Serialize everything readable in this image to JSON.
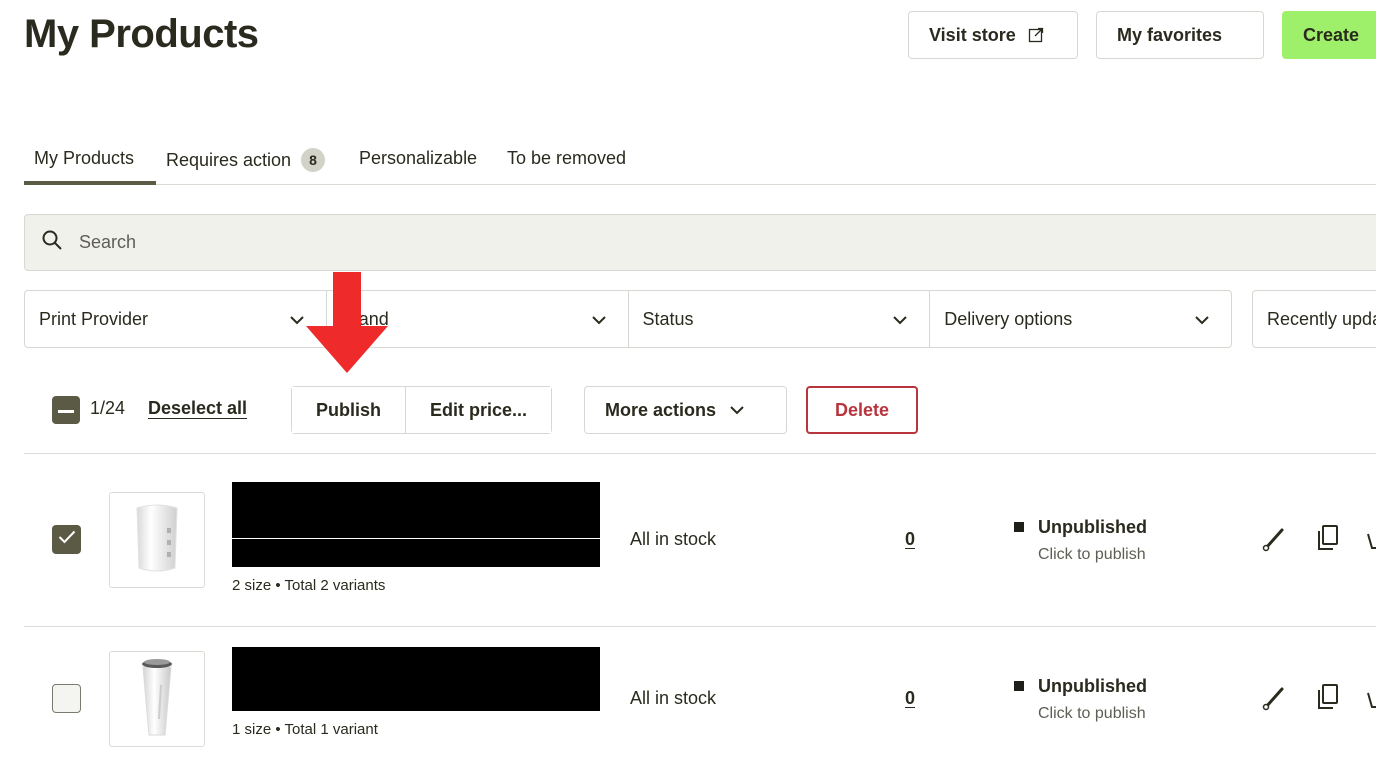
{
  "header": {
    "title": "My Products",
    "visit_store_label": "Visit store",
    "favorites_label": "My favorites",
    "create_label": "Create"
  },
  "tabs": [
    {
      "label": "My Products",
      "active": true
    },
    {
      "label": "Requires action",
      "badge": "8"
    },
    {
      "label": "Personalizable"
    },
    {
      "label": "To be removed"
    }
  ],
  "search": {
    "placeholder": "Search"
  },
  "filters": [
    {
      "label": "Print Provider"
    },
    {
      "label": "Brand"
    },
    {
      "label": "Status"
    },
    {
      "label": "Delivery options"
    }
  ],
  "sort": {
    "label": "Recently updated"
  },
  "bulk": {
    "count": "1/24",
    "deselect_label": "Deselect all",
    "publish_label": "Publish",
    "edit_price_label": "Edit price...",
    "more_actions_label": "More actions",
    "delete_label": "Delete"
  },
  "products": [
    {
      "checked": true,
      "variants": "2 size • Total 2 variants",
      "stock": "All in stock",
      "orders": "0",
      "status": "Unpublished",
      "status_hint": "Click to publish"
    },
    {
      "checked": false,
      "variants": "1 size • Total 1 variant",
      "stock": "All in stock",
      "orders": "0",
      "status": "Unpublished",
      "status_hint": "Click to publish"
    }
  ],
  "colors": {
    "accent_dark": "#5b5a44",
    "create_green": "#9ef06a",
    "delete_red": "#b8353d",
    "annotation_arrow": "#ee2a2a"
  }
}
